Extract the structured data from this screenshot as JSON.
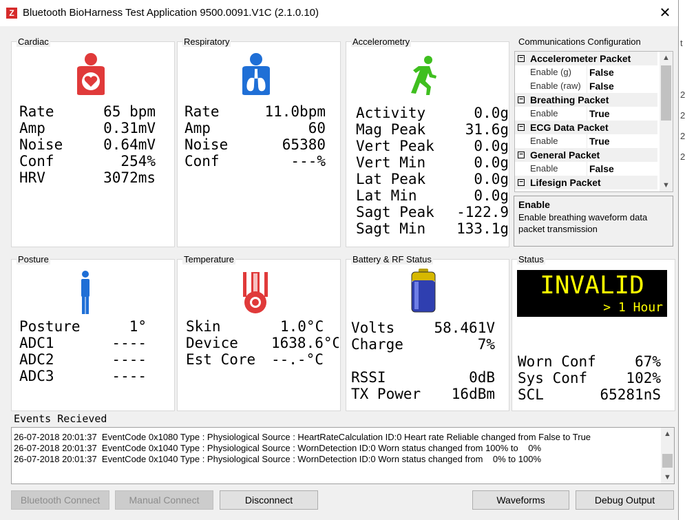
{
  "window": {
    "title": "Bluetooth BioHarness Test Application 9500.0091.V1C (2.1.0.10)",
    "icon_letter": "Z",
    "close_glyph": "✕"
  },
  "right_strip_chars": [
    "t",
    "2",
    "2",
    "2",
    "2"
  ],
  "cardiac": {
    "title": "Cardiac",
    "icon": "heart-person-icon",
    "rows": [
      {
        "label": "Rate",
        "value": "65 bpm"
      },
      {
        "label": "Amp",
        "value": "0.31mV"
      },
      {
        "label": "Noise",
        "value": "0.64mV"
      },
      {
        "label": "Conf",
        "value": "254%"
      },
      {
        "label": "HRV",
        "value": "3072ms"
      }
    ]
  },
  "respiratory": {
    "title": "Respiratory",
    "icon": "lungs-person-icon",
    "rows": [
      {
        "label": "Rate",
        "value": "11.0bpm"
      },
      {
        "label": "Amp",
        "value": "60"
      },
      {
        "label": "Noise",
        "value": "65380"
      },
      {
        "label": "Conf",
        "value": "---%"
      }
    ]
  },
  "accelerometry": {
    "title": "Accelerometry",
    "icon": "running-person-icon",
    "rows": [
      {
        "label": "Activity",
        "value": "0.0g"
      },
      {
        "label": "Mag Peak",
        "value": "31.6g"
      },
      {
        "label": "Vert Peak",
        "value": "0.0g"
      },
      {
        "label": "Vert Min",
        "value": "0.0g"
      },
      {
        "label": "Lat Peak",
        "value": "0.0g"
      },
      {
        "label": "Lat Min",
        "value": "0.0g"
      },
      {
        "label": "Sagt Peak",
        "value": "-122.9"
      },
      {
        "label": "Sagt Min",
        "value": "133.1g"
      }
    ]
  },
  "comms": {
    "title": "Communications Configuration",
    "tree": [
      {
        "kind": "cat",
        "text": "Accelerometer Packet"
      },
      {
        "kind": "prop",
        "name": "Enable (g)",
        "value": "False"
      },
      {
        "kind": "prop",
        "name": "Enable (raw)",
        "value": "False"
      },
      {
        "kind": "cat",
        "text": "Breathing Packet"
      },
      {
        "kind": "prop",
        "name": "Enable",
        "value": "True"
      },
      {
        "kind": "cat",
        "text": "ECG Data Packet"
      },
      {
        "kind": "prop",
        "name": "Enable",
        "value": "True"
      },
      {
        "kind": "cat",
        "text": "General Packet"
      },
      {
        "kind": "prop",
        "name": "Enable",
        "value": "False"
      },
      {
        "kind": "cat",
        "text": "Lifesign Packet"
      }
    ],
    "collapse_glyph": "−",
    "desc_title": "Enable",
    "desc_text": "Enable breathing waveform data packet transmission"
  },
  "posture": {
    "title": "Posture",
    "icon": "standing-person-icon",
    "rows": [
      {
        "label": "Posture",
        "value": "1°"
      },
      {
        "label": "ADC1",
        "value": "----"
      },
      {
        "label": "ADC2",
        "value": "----"
      },
      {
        "label": "ADC3",
        "value": "----"
      }
    ]
  },
  "temperature": {
    "title": "Temperature",
    "icon": "thermometer-icon",
    "rows": [
      {
        "label": "Skin",
        "value": "1.0°C"
      },
      {
        "label": "Device",
        "value": "1638.6°C"
      },
      {
        "label": "Est Core",
        "value": "--.-°C"
      }
    ]
  },
  "battery": {
    "title": "Battery & RF Status",
    "icon": "battery-icon",
    "rows": [
      {
        "label": "Volts",
        "value": "58.461V"
      },
      {
        "label": "Charge",
        "value": "7%"
      }
    ],
    "rf_rows": [
      {
        "label": "RSSI",
        "value": "0dB"
      },
      {
        "label": "TX Power",
        "value": "16dBm"
      }
    ]
  },
  "status": {
    "title": "Status",
    "state": "INVALID",
    "duration": "> 1 Hour",
    "rows": [
      {
        "label": "Worn Conf",
        "value": "67%"
      },
      {
        "label": "Sys Conf",
        "value": "102%"
      },
      {
        "label": "SCL",
        "value": "65281nS"
      }
    ]
  },
  "events": {
    "label": "Events Recieved",
    "lines": [
      "26-07-2018 20:01:37  EventCode 0x1080 Type : Physiological Source : HeartRateCalculation ID:0 Heart rate Reliable changed from False to True",
      "26-07-2018 20:01:37  EventCode 0x1040 Type : Physiological Source : WornDetection ID:0 Worn status changed from 100% to    0%",
      "26-07-2018 20:01:37  EventCode 0x1040 Type : Physiological Source : WornDetection ID:0 Worn status changed from    0% to 100%"
    ]
  },
  "buttons": {
    "bluetooth_connect": "Bluetooth Connect",
    "manual_connect": "Manual Connect",
    "disconnect": "Disconnect",
    "waveforms": "Waveforms",
    "debug_output": "Debug Output"
  },
  "colors": {
    "cardiac_icon": "#e03a3a",
    "respiratory_icon": "#1f6fd6",
    "accel_icon": "#3fbf1f",
    "posture_icon": "#1f6fd6",
    "temperature_icon": "#e03a3a",
    "status_bg": "#000000",
    "status_text": "#ffff00"
  }
}
